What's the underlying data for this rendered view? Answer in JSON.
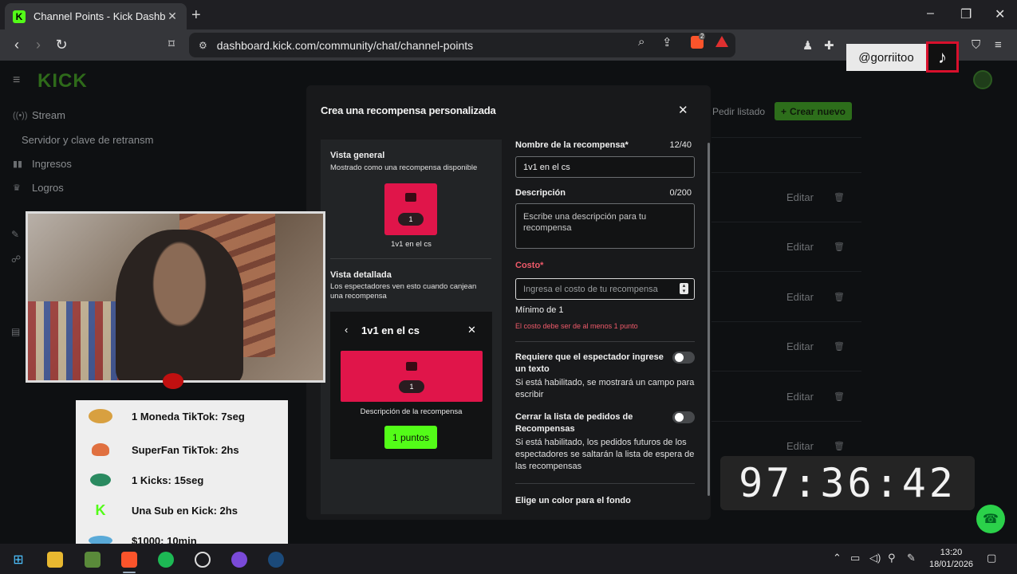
{
  "browser": {
    "tab_title": "Channel Points - Kick Dashboard",
    "tab_favicon": "K",
    "url": "dashboard.kick.com/community/chat/channel-points",
    "colors": {
      "tabbar": "#1f1f23",
      "toolbar": "#35363a",
      "omnibox": "#202124"
    }
  },
  "sidebar": {
    "logo": "KICK",
    "items": [
      {
        "label": "Stream",
        "icon": "stream-icon"
      },
      {
        "label": "Servidor y clave de retransm",
        "icon": ""
      },
      {
        "label": "Ingresos",
        "icon": "bar-chart-icon"
      },
      {
        "label": "Logros",
        "icon": "trophy-icon"
      }
    ]
  },
  "dashboard": {
    "pedir_listado": "Pedir listado",
    "crear_nuevo": "Crear nuevo",
    "row_edit_label": "Editar",
    "row_count": 6,
    "accent": "#53fc18"
  },
  "modal": {
    "title": "Crea una recompensa personalizada",
    "close_icon": "close-icon",
    "preview": {
      "general_title": "Vista general",
      "general_subtitle": "Mostrado como una recompensa disponible",
      "tile_cost": "1",
      "tile_label": "1v1 en el cs",
      "detail_title": "Vista detallada",
      "detail_subtitle": "Los espectadores ven esto cuando canjean una recompensa",
      "detail_header": "1v1 en el cs",
      "detail_cost": "1",
      "detail_description": "Descripción de la recompensa",
      "detail_button": "1 puntos",
      "tile_color": "#e0154a"
    },
    "form": {
      "name_label": "Nombre de la recompensa*",
      "name_count": "12/40",
      "name_value": "1v1 en el cs",
      "desc_label": "Descripción",
      "desc_count": "0/200",
      "desc_placeholder": "Escribe una descripción para tu recompensa",
      "cost_label": "Costo*",
      "cost_placeholder": "Ingresa el costo de tu recompensa",
      "cost_min": "Mínimo de 1",
      "cost_error": "El costo debe ser de al menos 1 punto",
      "require_text_label": "Requiere que el espectador ingrese un texto",
      "require_text_help": "Si está habilitado, se mostrará un campo para escribir",
      "require_text_on": false,
      "close_queue_label": "Cerrar la lista de pedidos de Recompensas",
      "close_queue_help": "Si está habilitado, los pedidos futuros de los espectadores se saltarán la lista de espera de las recompensas",
      "close_queue_on": false,
      "bg_color_label": "Elige un color para el fondo"
    }
  },
  "overlays": {
    "tiktok_handle": "@gorriitoo",
    "timer": "97:36:42",
    "goals": [
      {
        "icon": "coin-icon",
        "text": "1 Moneda TikTok: 7seg"
      },
      {
        "icon": "superfan-icon",
        "text": "SuperFan TikTok: 2hs"
      },
      {
        "icon": "kicks-icon",
        "text": "1 Kicks: 15seg"
      },
      {
        "icon": "kick-logo-icon",
        "text": "Una Sub en Kick: 2hs"
      },
      {
        "icon": "money-icon",
        "text": "$1000: 10min"
      }
    ]
  },
  "taskbar": {
    "time": "13:20",
    "date": "18/01/2026"
  }
}
